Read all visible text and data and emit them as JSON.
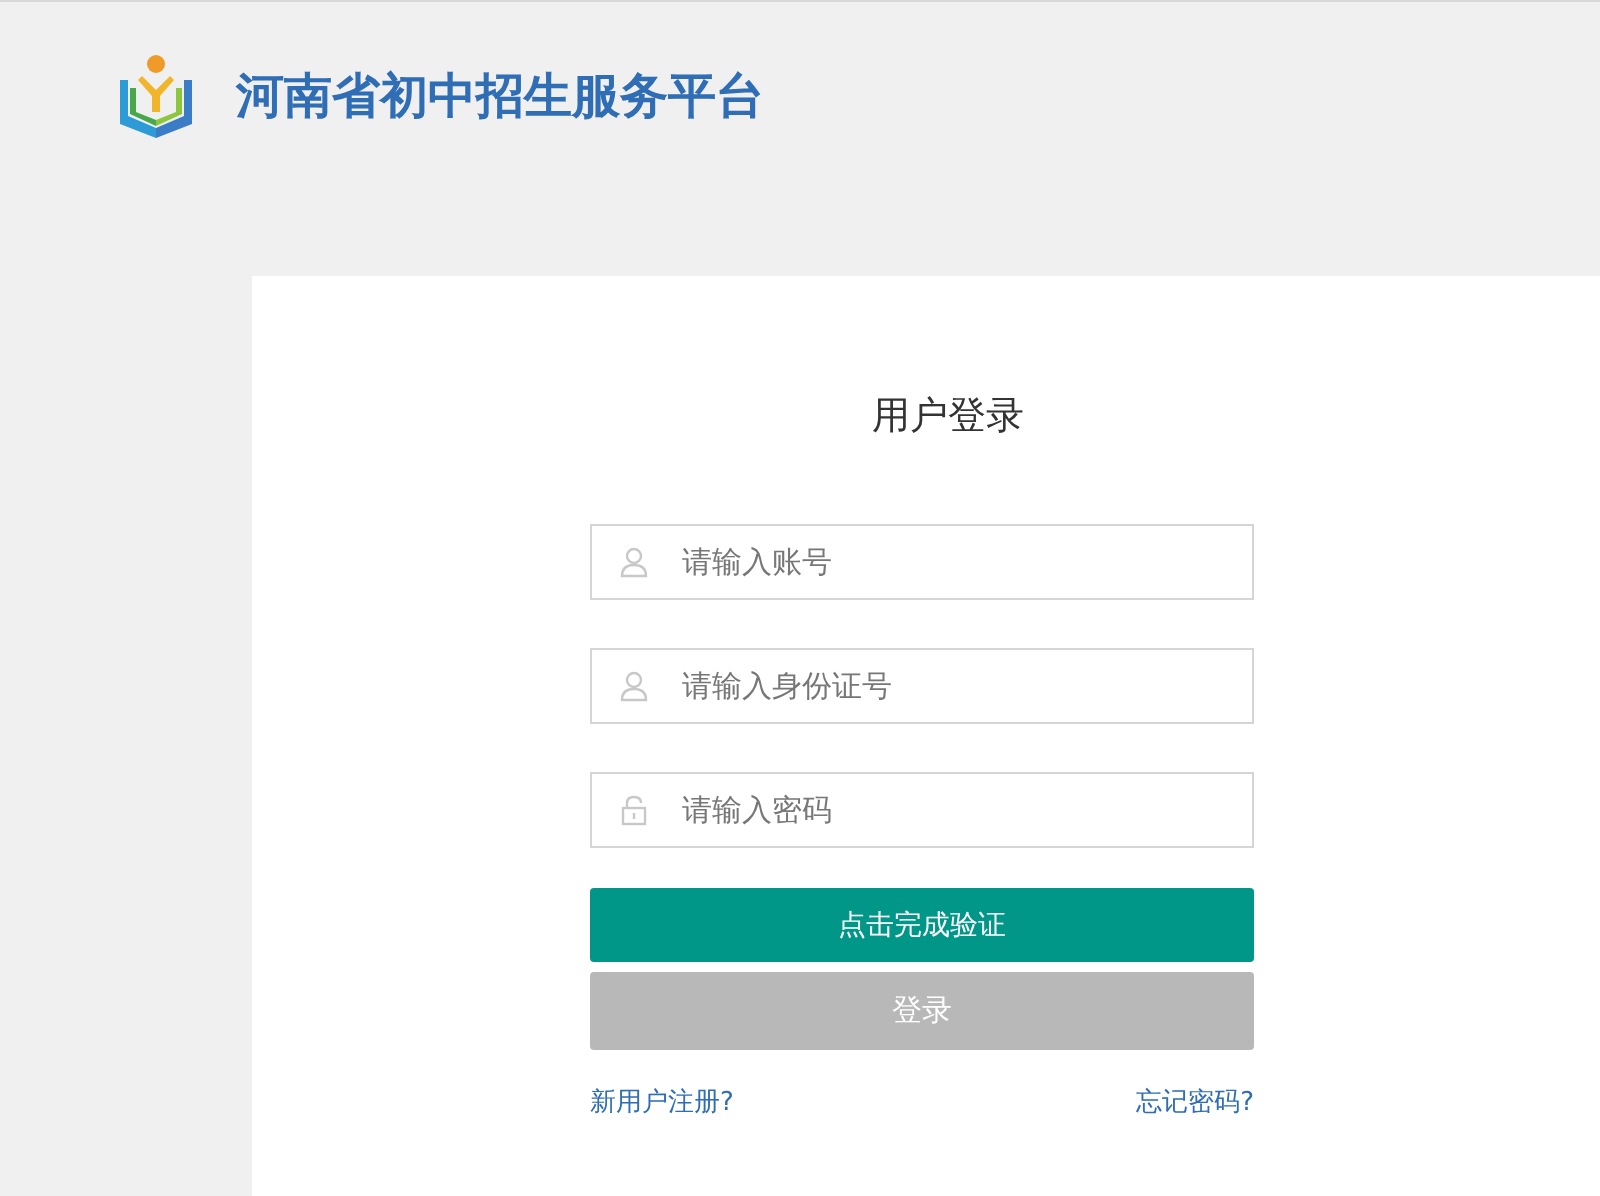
{
  "header": {
    "title": "河南省初中招生服务平台"
  },
  "login": {
    "title": "用户登录",
    "fields": [
      {
        "kind": "user",
        "placeholder": "请输入账号"
      },
      {
        "kind": "user",
        "placeholder": "请输入身份证号"
      },
      {
        "kind": "lock",
        "placeholder": "请输入密码"
      }
    ],
    "verify_button": "点击完成验证",
    "login_button": {
      "label": "登录",
      "disabled": true
    },
    "links": [
      {
        "label": "新用户注册?"
      },
      {
        "label": "忘记密码?"
      }
    ]
  }
}
